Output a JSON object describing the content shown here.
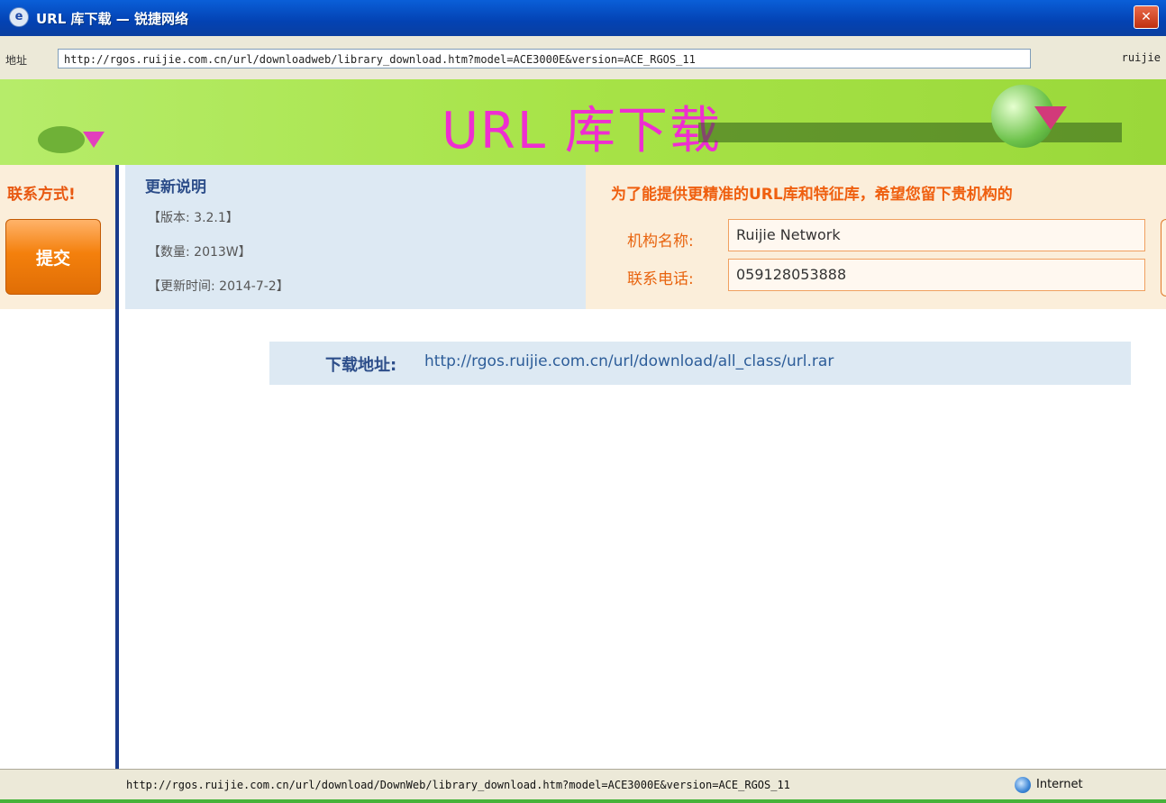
{
  "window": {
    "title": "URL 库下载 — 锐捷网络",
    "close_glyph": "✕",
    "app_icon_glyph": "e"
  },
  "address_bar": {
    "label": "地址",
    "url": "http://rgos.ruijie.com.cn/url/downloadweb/library_download.htm?model=ACE3000E&version=ACE_RGOS_11",
    "tail": "ruijie"
  },
  "banner": {
    "title": "URL 库下载"
  },
  "left_panel": {
    "contact_label": "联系方式!",
    "submit_label": "提交"
  },
  "update_panel": {
    "heading": "更新说明",
    "version": "【版本: 3.2.1】",
    "count": "【数量: 2013W】",
    "update_time": "【更新时间: 2014-7-2】"
  },
  "form_panel": {
    "headline": "为了能提供更精准的URL库和特征库，希望您留下贵机构的",
    "org_label": "机构名称:",
    "org_value": "Ruijie Network",
    "phone_label": "联系电话:",
    "phone_value": "059128053888"
  },
  "download": {
    "label": "下载地址:",
    "link": "http://rgos.ruijie.com.cn/url/download/all_class/url.rar"
  },
  "status_bar": {
    "text": "http://rgos.ruijie.com.cn/url/download/DownWeb/library_download.htm?model=ACE3000E&version=ACE_RGOS_11",
    "zone": "Internet"
  },
  "colors": {
    "titlebar": "#0342b3",
    "banner_green": "#a7e347",
    "accent_orange": "#ef5f0f",
    "info_blue": "#2d4e8a",
    "panel_blue": "#dde9f3",
    "panel_cream": "#fbeeda"
  }
}
